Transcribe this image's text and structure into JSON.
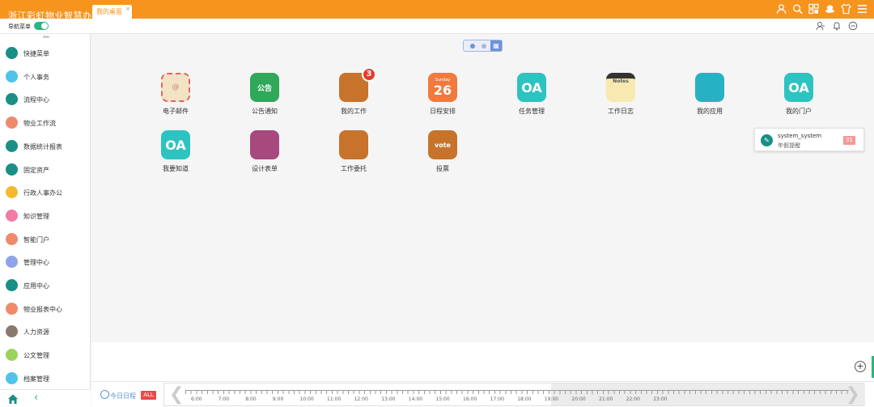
{
  "header": {
    "app_title": "浙江彩虹物业智慧办公",
    "tab": {
      "label": "我的桌面",
      "close": "×"
    },
    "icons": [
      "user-icon",
      "search-icon",
      "grid-icon",
      "hat-icon",
      "shirt-icon",
      "menu-icon"
    ],
    "bg_color": "#f7941e"
  },
  "subbar": {
    "nav_label": "导航菜单",
    "toggle_on": true,
    "icons": [
      "contacts-icon",
      "bell-icon",
      "minus-circle-icon"
    ]
  },
  "sidebar": {
    "items": [
      {
        "label": "快捷菜单",
        "icon": "share-icon",
        "color": "#1a8f85"
      },
      {
        "label": "个人事务",
        "icon": "person-icon",
        "color": "#4fc3e8"
      },
      {
        "label": "流程中心",
        "icon": "upload-icon",
        "color": "#1a8f85"
      },
      {
        "label": "物业工作流",
        "icon": "hand-icon",
        "color": "#f08a6c"
      },
      {
        "label": "数据统计报表",
        "icon": "ie-icon",
        "color": "#1a8f85"
      },
      {
        "label": "固定资产",
        "icon": "ie-icon",
        "color": "#1a8f85"
      },
      {
        "label": "行政人事办公",
        "icon": "layers-icon",
        "color": "#f5b930"
      },
      {
        "label": "知识管理",
        "icon": "book-icon",
        "color": "#f07ba5"
      },
      {
        "label": "智能门户",
        "icon": "calc-icon",
        "color": "#f08a6c"
      },
      {
        "label": "管理中心",
        "icon": "doc-icon",
        "color": "#8ea4e8"
      },
      {
        "label": "应用中心",
        "icon": "pen-icon",
        "color": "#1a8f85"
      },
      {
        "label": "物业报表中心",
        "icon": "chart-icon",
        "color": "#f08a6c"
      },
      {
        "label": "人力资源",
        "icon": "bars-icon",
        "color": "#8a7a6e"
      },
      {
        "label": "公文管理",
        "icon": "folder-icon",
        "color": "#9bd35a"
      },
      {
        "label": "档案管理",
        "icon": "archive-icon",
        "color": "#4fc3e8"
      }
    ],
    "back_symbol": "‹"
  },
  "desktop": {
    "apps": [
      {
        "label": "电子邮件",
        "icon": "email-icon",
        "glyph": "@",
        "color": "#f2e3c4"
      },
      {
        "label": "公告通知",
        "icon": "notice-icon",
        "glyph": "公告",
        "color": "#2fa85a"
      },
      {
        "label": "我的工作",
        "icon": "work-icon",
        "glyph": "",
        "color": "#c8732c",
        "badge": "3"
      },
      {
        "label": "日程安排",
        "icon": "calendar-icon",
        "glyph": "26",
        "glyph_top": "Sunday",
        "color": "#f07a3d"
      },
      {
        "label": "任务管理",
        "icon": "oa-icon",
        "glyph": "OA",
        "color": "#2dc3c1"
      },
      {
        "label": "工作日志",
        "icon": "notes-icon",
        "glyph": "Notes",
        "color": "#f7e9b0"
      },
      {
        "label": "我的应用",
        "icon": "apps-icon",
        "glyph": "",
        "color": "#27b2c4"
      },
      {
        "label": "我的门户",
        "icon": "oa-icon",
        "glyph": "OA",
        "color": "#2dc3c1"
      },
      {
        "label": "我要知道",
        "icon": "oa-icon",
        "glyph": "OA",
        "color": "#2dc3c1"
      },
      {
        "label": "设计表单",
        "icon": "form-icon",
        "glyph": "",
        "color": "#a8497e"
      },
      {
        "label": "工作委托",
        "icon": "delegate-icon",
        "glyph": "",
        "color": "#c8732c"
      },
      {
        "label": "投票",
        "icon": "vote-icon",
        "glyph": "vote",
        "color": "#c8732c"
      }
    ]
  },
  "notice": {
    "user": "system_system",
    "type": "年假提醒",
    "count": "31"
  },
  "schedule": {
    "label": "今日日程",
    "all": "ALL",
    "times": [
      "6:00",
      "7:00",
      "8:00",
      "9:00",
      "10:00",
      "11:00",
      "12:00",
      "13:00",
      "14:00",
      "15:00",
      "16:00",
      "17:00",
      "18:00",
      "19:00",
      "20:00",
      "21:00",
      "22:00",
      "23:00"
    ]
  },
  "plus": "+"
}
